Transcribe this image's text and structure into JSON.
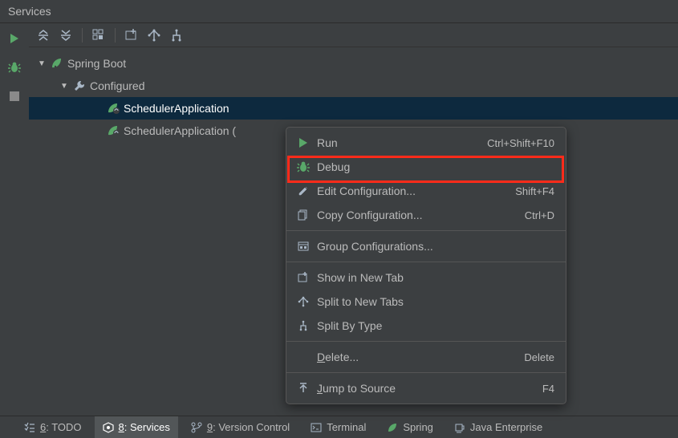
{
  "colors": {
    "accent_green": "#59a869",
    "accent_run": "#59a869",
    "highlight_red": "#ff2b1a",
    "selected_bg": "#0d293e"
  },
  "panel": {
    "title": "Services"
  },
  "tree": {
    "root": {
      "label": "Spring Boot"
    },
    "configured": {
      "label": "Configured"
    },
    "apps": [
      {
        "label": "SchedulerApplication",
        "selected": true
      },
      {
        "label": "SchedulerApplication (",
        "selected": false
      }
    ]
  },
  "context_menu": {
    "items": [
      {
        "id": "run",
        "label": "Run",
        "shortcut": "Ctrl+Shift+F10",
        "icon": "play"
      },
      {
        "id": "debug",
        "label": "Debug",
        "shortcut": "",
        "icon": "bug",
        "highlighted": true
      },
      {
        "id": "edit",
        "label": "Edit Configuration...",
        "shortcut": "Shift+F4",
        "icon": "pencil"
      },
      {
        "id": "copy",
        "label": "Copy Configuration...",
        "shortcut": "Ctrl+D",
        "icon": "copy"
      },
      {
        "separator": true
      },
      {
        "id": "group",
        "label": "Group Configurations...",
        "shortcut": "",
        "icon": "group"
      },
      {
        "separator": true
      },
      {
        "id": "newtab",
        "label": "Show in New Tab",
        "shortcut": "",
        "icon": "newtab"
      },
      {
        "id": "split",
        "label": "Split to New Tabs",
        "shortcut": "",
        "icon": "split"
      },
      {
        "id": "splittype",
        "label": "Split By Type",
        "shortcut": "",
        "icon": "splittype"
      },
      {
        "separator": true
      },
      {
        "id": "delete",
        "label": "Delete...",
        "underline_index": 0,
        "shortcut": "Delete",
        "icon": ""
      },
      {
        "separator": true
      },
      {
        "id": "jump",
        "label": "Jump to Source",
        "underline_index": 0,
        "shortcut": "F4",
        "icon": "jump"
      }
    ]
  },
  "status_bar": {
    "items": [
      {
        "id": "todo",
        "prefix": "6",
        "label": ": TODO",
        "icon": "checklist"
      },
      {
        "id": "services",
        "prefix": "8",
        "label": ": Services",
        "icon": "services",
        "active": true
      },
      {
        "id": "vcs",
        "prefix": "9",
        "label": ": Version Control",
        "icon": "branch"
      },
      {
        "id": "terminal",
        "prefix": "",
        "label": "Terminal",
        "icon": "terminal"
      },
      {
        "id": "spring",
        "prefix": "",
        "label": "Spring",
        "icon": "leaf"
      },
      {
        "id": "javaee",
        "prefix": "",
        "label": "Java Enterprise",
        "icon": "javaee"
      }
    ]
  }
}
